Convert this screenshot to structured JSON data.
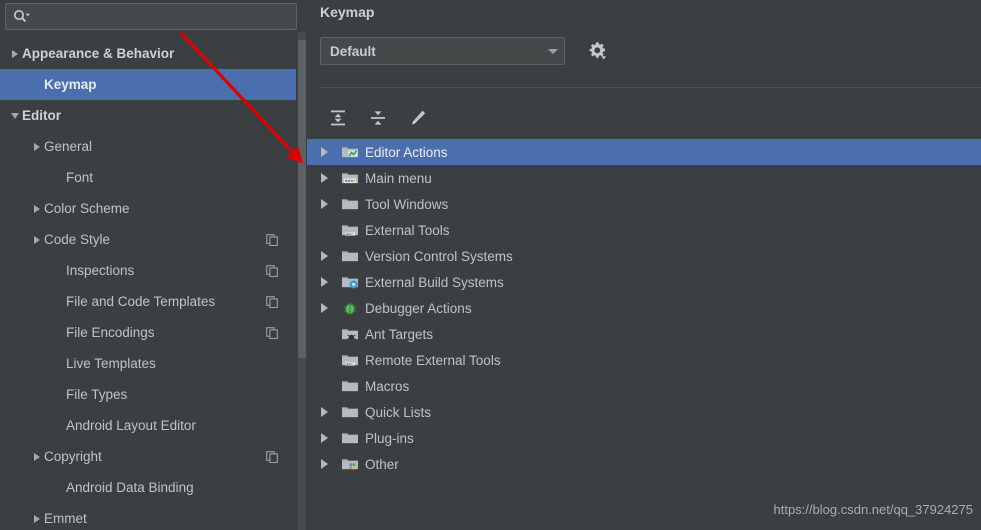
{
  "search": {
    "placeholder": "",
    "value": "",
    "icon": "search-icon",
    "dropdown_icon": "chevron-down-icon"
  },
  "sidebar": {
    "items": [
      {
        "label": "Appearance & Behavior",
        "indent": 8,
        "twisty": "collapsed",
        "bold": true,
        "selected": false,
        "copy_icon": false
      },
      {
        "label": "Keymap",
        "indent": 30,
        "twisty": "none",
        "bold": true,
        "selected": true,
        "copy_icon": false
      },
      {
        "label": "Editor",
        "indent": 8,
        "twisty": "expanded",
        "bold": true,
        "selected": false,
        "copy_icon": false
      },
      {
        "label": "General",
        "indent": 30,
        "twisty": "collapsed",
        "bold": false,
        "selected": false,
        "copy_icon": false
      },
      {
        "label": "Font",
        "indent": 52,
        "twisty": "none",
        "bold": false,
        "selected": false,
        "copy_icon": false
      },
      {
        "label": "Color Scheme",
        "indent": 30,
        "twisty": "collapsed",
        "bold": false,
        "selected": false,
        "copy_icon": false
      },
      {
        "label": "Code Style",
        "indent": 30,
        "twisty": "collapsed",
        "bold": false,
        "selected": false,
        "copy_icon": true
      },
      {
        "label": "Inspections",
        "indent": 52,
        "twisty": "none",
        "bold": false,
        "selected": false,
        "copy_icon": true
      },
      {
        "label": "File and Code Templates",
        "indent": 52,
        "twisty": "none",
        "bold": false,
        "selected": false,
        "copy_icon": true
      },
      {
        "label": "File Encodings",
        "indent": 52,
        "twisty": "none",
        "bold": false,
        "selected": false,
        "copy_icon": true
      },
      {
        "label": "Live Templates",
        "indent": 52,
        "twisty": "none",
        "bold": false,
        "selected": false,
        "copy_icon": false
      },
      {
        "label": "File Types",
        "indent": 52,
        "twisty": "none",
        "bold": false,
        "selected": false,
        "copy_icon": false
      },
      {
        "label": "Android Layout Editor",
        "indent": 52,
        "twisty": "none",
        "bold": false,
        "selected": false,
        "copy_icon": false
      },
      {
        "label": "Copyright",
        "indent": 30,
        "twisty": "collapsed",
        "bold": false,
        "selected": false,
        "copy_icon": true
      },
      {
        "label": "Android Data Binding",
        "indent": 52,
        "twisty": "none",
        "bold": false,
        "selected": false,
        "copy_icon": false
      },
      {
        "label": "Emmet",
        "indent": 30,
        "twisty": "collapsed",
        "bold": false,
        "selected": false,
        "copy_icon": false
      }
    ],
    "scrollbar": {
      "name": "sidebar-scrollbar"
    }
  },
  "right": {
    "title": "Keymap",
    "keymap_select": {
      "value": "Default",
      "options": [
        "Default"
      ],
      "arrow_icon": "chevron-down-icon"
    },
    "gear_button": {
      "icon": "gear-icon",
      "label": ""
    },
    "toolbar": [
      {
        "icon": "expand-all-icon",
        "label": ""
      },
      {
        "icon": "collapse-all-icon",
        "label": ""
      },
      {
        "icon": "edit-pencil-icon",
        "label": ""
      }
    ],
    "tree": [
      {
        "label": "Editor Actions",
        "twisty": "collapsed",
        "icon": "folder-editor-icon",
        "selected": true
      },
      {
        "label": "Main menu",
        "twisty": "collapsed",
        "icon": "folder-menu-icon",
        "selected": false
      },
      {
        "label": "Tool Windows",
        "twisty": "collapsed",
        "icon": "folder-icon",
        "selected": false
      },
      {
        "label": "External Tools",
        "twisty": "none",
        "icon": "folder-tools-icon",
        "selected": false
      },
      {
        "label": "Version Control Systems",
        "twisty": "collapsed",
        "icon": "folder-icon",
        "selected": false
      },
      {
        "label": "External Build Systems",
        "twisty": "collapsed",
        "icon": "folder-build-icon",
        "selected": false
      },
      {
        "label": "Debugger Actions",
        "twisty": "collapsed",
        "icon": "bug-icon",
        "selected": false
      },
      {
        "label": "Ant Targets",
        "twisty": "none",
        "icon": "folder-ant-icon",
        "selected": false
      },
      {
        "label": "Remote External Tools",
        "twisty": "none",
        "icon": "folder-tools-icon",
        "selected": false
      },
      {
        "label": "Macros",
        "twisty": "none",
        "icon": "folder-icon",
        "selected": false
      },
      {
        "label": "Quick Lists",
        "twisty": "collapsed",
        "icon": "folder-icon",
        "selected": false
      },
      {
        "label": "Plug-ins",
        "twisty": "collapsed",
        "icon": "folder-icon",
        "selected": false
      },
      {
        "label": "Other",
        "twisty": "collapsed",
        "icon": "folder-other-icon",
        "selected": false
      }
    ]
  },
  "watermark": "https://blog.csdn.net/qq_37924275",
  "colors": {
    "background": "#3c3f41",
    "selection": "#4b6eaf",
    "text": "#bfc3c7",
    "field": "#45494a",
    "border": "#5e6364",
    "annotation": "#e00000"
  }
}
